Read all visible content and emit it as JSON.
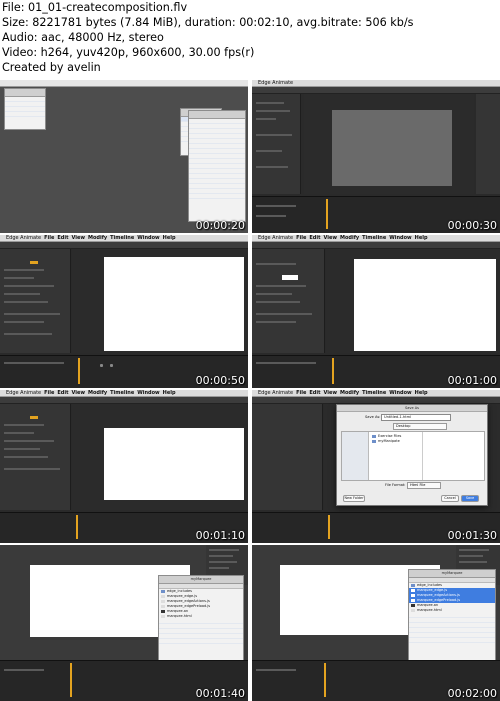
{
  "header": {
    "file": "File: 01_01-createcomposition.flv",
    "size": "Size: 8221781 bytes (7.84 MiB), duration: 00:02:10, avg.bitrate: 506 kb/s",
    "audio": "Audio: aac, 48000 Hz, stereo",
    "video": "Video: h264, yuv420p, 960x600, 30.00 fps(r)",
    "created": "Created by avelin"
  },
  "app": {
    "name": "Edge Animate",
    "menu": [
      "File",
      "Edit",
      "View",
      "Modify",
      "Timeline",
      "Window",
      "Help"
    ]
  },
  "thumbnails": [
    {
      "timestamp": "00:00:20"
    },
    {
      "timestamp": "00:00:30"
    },
    {
      "timestamp": "00:00:50"
    },
    {
      "timestamp": "00:01:00"
    },
    {
      "timestamp": "00:01:10"
    },
    {
      "timestamp": "00:01:30"
    },
    {
      "timestamp": "00:01:40"
    },
    {
      "timestamp": "00:02:00"
    }
  ],
  "dialog": {
    "title": "Save As",
    "save_as_label": "Save As:",
    "save_as_value": "Untitled-1.html",
    "folder": "Desktop",
    "items": [
      "Exercise Files",
      "myManipate"
    ],
    "file_format_label": "File Format:",
    "file_format_value": "Html File",
    "new_folder": "New Folder",
    "cancel": "Cancel",
    "save": "Save"
  },
  "finder": {
    "folder": "myMarquee",
    "files": [
      "edge_includes",
      "marquee_edge.js",
      "marquee_edgeActions.js",
      "marquee_edgePreload.js",
      "marquee.an",
      "marquee.html"
    ]
  },
  "colors": {
    "app_bg": "#2b2b2b",
    "panel": "#353535",
    "accent_orange": "#e3a320",
    "selection_blue": "#3f7de0"
  }
}
